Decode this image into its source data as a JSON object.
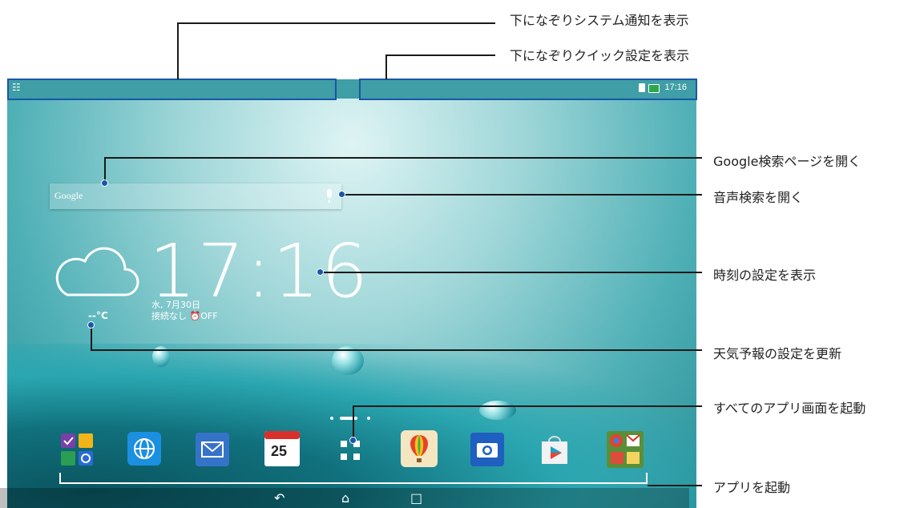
{
  "status_bar": {
    "time": "17:16"
  },
  "home": {
    "search": {
      "label": "Google"
    },
    "clock": {
      "time": "17:16",
      "date": "水, 7月30日",
      "alarm_status": "接続なし",
      "alarm": "OFF"
    },
    "weather": {
      "temp": "--°C"
    },
    "dock": [
      {
        "name": "app-folder-icon"
      },
      {
        "name": "browser-icon"
      },
      {
        "name": "email-icon"
      },
      {
        "name": "calendar-icon",
        "label": "25"
      },
      {
        "name": "all-apps-icon"
      },
      {
        "name": "hot-air-balloon-icon"
      },
      {
        "name": "camera-icon"
      },
      {
        "name": "play-store-icon"
      },
      {
        "name": "google-apps-folder-icon"
      }
    ]
  },
  "callouts": {
    "notifications": "下になぞりシステム通知を表示",
    "quick_settings": "下になぞりクイック設定を表示",
    "google_search": "Google検索ページを開く",
    "voice_search": "音声検索を開く",
    "time_settings": "時刻の設定を表示",
    "weather": "天気予報の設定を更新",
    "all_apps": "すべてのアプリ画面を起動",
    "launch_apps": "アプリを起動"
  },
  "colors": {
    "highlight": "#1a56a8",
    "wallpaper": "#4fb0b6",
    "line": "#1a1a1a"
  }
}
